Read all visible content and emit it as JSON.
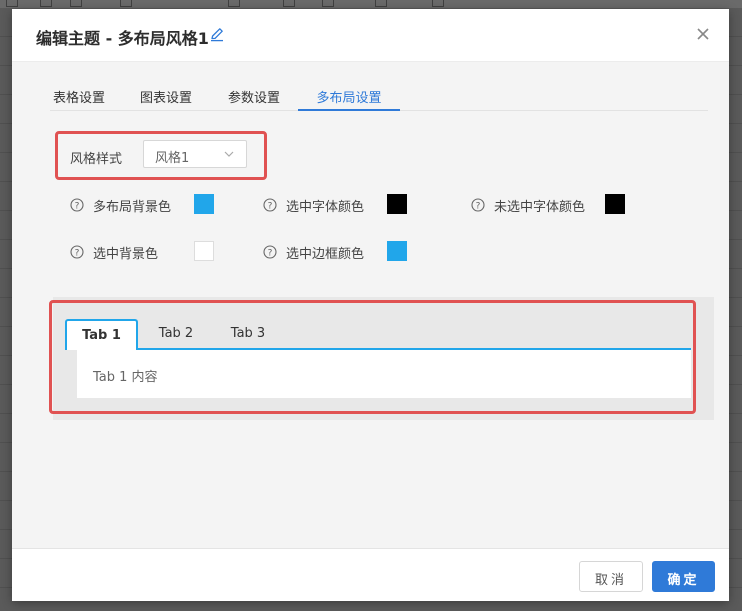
{
  "dialog": {
    "title": "编辑主题 - 多布局风格1",
    "edit_icon": "pencil-icon",
    "close_icon": "close-icon"
  },
  "tabs": [
    {
      "label": "表格设置",
      "active": false
    },
    {
      "label": "图表设置",
      "active": false
    },
    {
      "label": "参数设置",
      "active": false
    },
    {
      "label": "多布局设置",
      "active": true
    }
  ],
  "style_select": {
    "label": "风格样式",
    "value": "风格1",
    "icon": "chevron-down-icon"
  },
  "properties": [
    {
      "label": "多布局背景色",
      "color": "#21A6EA"
    },
    {
      "label": "选中字体颜色",
      "color": "#000000"
    },
    {
      "label": "未选中字体颜色",
      "color": "#000000"
    },
    {
      "label": "选中背景色",
      "color": "#FFFFFF"
    },
    {
      "label": "选中边框颜色",
      "color": "#21A6EA"
    }
  ],
  "preview": {
    "tabs": [
      {
        "label": "Tab 1",
        "active": true
      },
      {
        "label": "Tab 2",
        "active": false
      },
      {
        "label": "Tab 3",
        "active": false
      }
    ],
    "content": "Tab 1 内容"
  },
  "footer": {
    "cancel_label": "取消",
    "ok_label": "确定"
  },
  "colors": {
    "accent": "#2F7AD8",
    "highlight": "#E05252"
  }
}
